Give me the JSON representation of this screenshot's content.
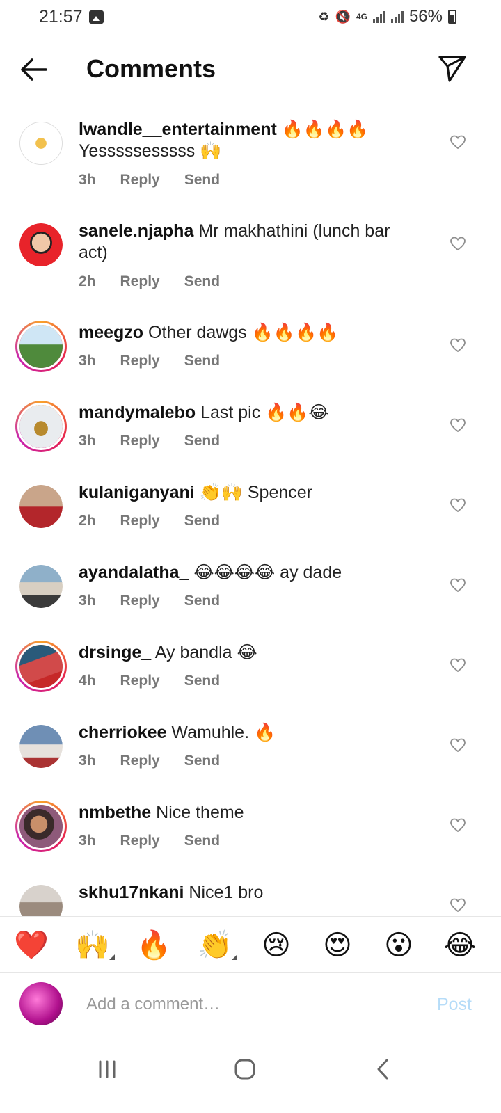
{
  "status_bar": {
    "time": "21:57",
    "network": "4G",
    "battery": "56%"
  },
  "header": {
    "title": "Comments"
  },
  "comments": [
    {
      "username": "lwandle__entertainment",
      "text": "🔥🔥🔥🔥",
      "text2": "Yesssssesssss 🙌",
      "time": "3h",
      "reply": "Reply",
      "send": "Send"
    },
    {
      "username": "sanele.njapha",
      "text": "Mr makhathini (lunch bar act)",
      "time": "2h",
      "reply": "Reply",
      "send": "Send"
    },
    {
      "username": "meegzo",
      "text": "Other dawgs 🔥🔥🔥🔥",
      "time": "3h",
      "reply": "Reply",
      "send": "Send"
    },
    {
      "username": "mandymalebo",
      "text": "Last pic 🔥🔥😂",
      "time": "3h",
      "reply": "Reply",
      "send": "Send"
    },
    {
      "username": "kulaniganyani",
      "text": "👏🙌 Spencer",
      "time": "2h",
      "reply": "Reply",
      "send": "Send"
    },
    {
      "username": "ayandalatha_",
      "text": "😂😂😂😂 ay dade",
      "time": "3h",
      "reply": "Reply",
      "send": "Send"
    },
    {
      "username": "drsinge_",
      "text": "Ay bandla 😂",
      "time": "4h",
      "reply": "Reply",
      "send": "Send"
    },
    {
      "username": "cherriokee",
      "text": "Wamuhle. 🔥",
      "time": "3h",
      "reply": "Reply",
      "send": "Send"
    },
    {
      "username": "nmbethe",
      "text": "Nice theme",
      "time": "3h",
      "reply": "Reply",
      "send": "Send"
    },
    {
      "username": "skhu17nkani",
      "text": "Nice1 bro",
      "time": "",
      "reply": "",
      "send": ""
    }
  ],
  "emoji_bar": [
    "❤️",
    "🙌",
    "🔥",
    "👏",
    "😢",
    "😍",
    "😮",
    "😂"
  ],
  "composer": {
    "placeholder": "Add a comment…",
    "post_label": "Post"
  },
  "colors": {
    "story_ring": "#e6204f",
    "post_disabled": "#b6dcf8",
    "meta_text": "#777777"
  }
}
